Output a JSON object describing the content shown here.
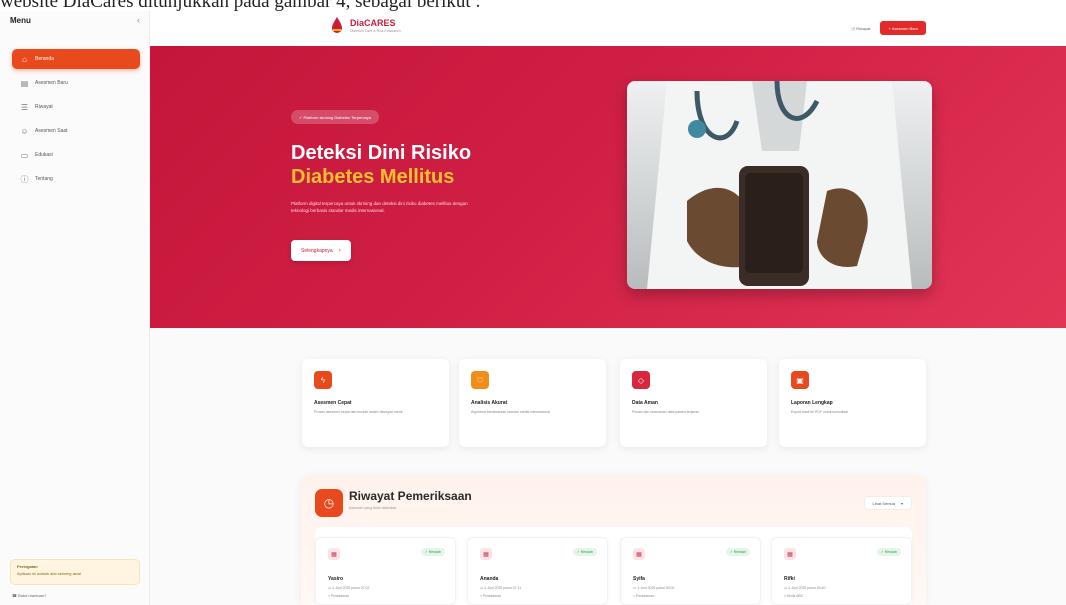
{
  "document": {
    "caption": "website DiaCares ditunjukkan pada gambar 4, sebagai berikut :"
  },
  "sidebar": {
    "title": "Menu",
    "collapse_icon": "chevron-left-icon",
    "items": [
      {
        "label": "Beranda",
        "icon": "home-icon",
        "active": true
      },
      {
        "label": "Asesmen Baru",
        "icon": "clipboard-icon",
        "active": false
      },
      {
        "label": "Riwayat",
        "icon": "history-icon",
        "active": false
      },
      {
        "label": "Asesmen Saat",
        "icon": "user-icon",
        "active": false
      },
      {
        "label": "Edukasi",
        "icon": "book-icon",
        "active": false
      },
      {
        "label": "Tentang",
        "icon": "info-icon",
        "active": false
      }
    ],
    "note": {
      "title": "Peringatan",
      "text": "Aplikasi ini adalah alat skrining awal"
    },
    "help": "Butuh bantuan?"
  },
  "topbar": {
    "brand_name": "DiaCARES",
    "brand_tagline": "Diabetes Care & Risk Evaluation",
    "history_link": "Riwayat",
    "cta_label": "Asesmen Baru"
  },
  "hero": {
    "badge": "Platform skrining Diabetes Terpercaya",
    "title_line1": "Deteksi Dini Risiko",
    "title_line2": "Diabetes Mellitus",
    "description": "Platform digital terpercaya untuk skrining dan deteksi dini risiko diabetes mellitus dengan teknologi berbasis standar medis internasional.",
    "button_label": "Selengkapnya"
  },
  "features": [
    {
      "title": "Asesmen Cepat",
      "desc": "Proses asesmen cepat dan mudah dalam hitungan menit",
      "color": "#e8491d",
      "icon": "lightning-icon"
    },
    {
      "title": "Analisis Akurat",
      "desc": "Algoritma berdasarkan standar medis internasional",
      "color": "#f28c1a",
      "icon": "heart-icon"
    },
    {
      "title": "Data Aman",
      "desc": "Privasi dan keamanan data pasien terjamin",
      "color": "#d7263d",
      "icon": "shield-icon"
    },
    {
      "title": "Laporan Lengkap",
      "desc": "Export hasil ke PDF untuk konsultasi",
      "color": "#e8491d",
      "icon": "document-icon"
    }
  ],
  "history": {
    "title": "Riwayat Pemeriksaan",
    "subtitle": "Asesmen yang telah dilakukan",
    "filter_label": "Lihat Semua",
    "records": [
      {
        "name": "Yasiro",
        "date": "1 Juni 2025 pukul 07.02",
        "location": "Puskesmas",
        "status": "Rendah"
      },
      {
        "name": "Ananda",
        "date": "1 Juni 2025 pukul 07.11",
        "location": "Puskesmas",
        "status": "Rendah"
      },
      {
        "name": "Syifa",
        "date": "1 Juni 2025 pukul 09.00",
        "location": "Puskesmas",
        "status": "Rendah"
      },
      {
        "name": "Rifki",
        "date": "1 Juni 2025 pukul 09.40",
        "location": "Klinik ABC",
        "status": "Rendah"
      }
    ]
  }
}
